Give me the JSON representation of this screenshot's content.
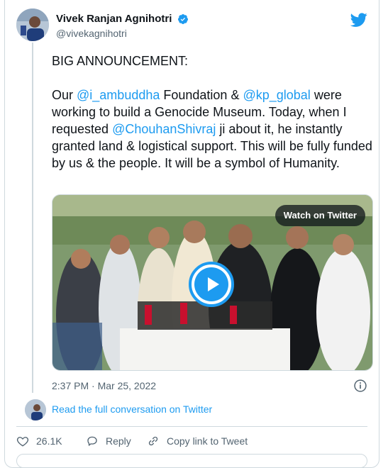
{
  "author": {
    "name": "Vivek Ranjan Agnihotri",
    "handle": "@vivekagnihotri",
    "verified": true,
    "avatar_icon": "profile-avatar"
  },
  "brand_icon": "twitter-bird-icon",
  "colors": {
    "accent": "#1d9bf0",
    "text": "#0f1419",
    "muted": "#536471",
    "border": "#cfd9de"
  },
  "tweet": {
    "line1": "BIG ANNOUNCEMENT:",
    "para2": {
      "t1": "Our ",
      "m1": "@i_ambuddha",
      "t2": " Foundation & ",
      "m2": "@kp_global",
      "t3": " were working to build a Genocide Museum. Today, when I requested ",
      "m3": "@ChouhanShivraj",
      "t4": " ji about it, he instantly granted land & logistical support. This will be fully funded by us & the people. It will be a symbol of Humanity."
    }
  },
  "media": {
    "watch_label": "Watch on Twitter",
    "play_icon": "play-icon"
  },
  "timestamp": "2:37 PM · Mar 25, 2022",
  "read_conversation": "Read the full conversation on Twitter",
  "actions": {
    "likes": "26.1K",
    "reply": "Reply",
    "copy_link": "Copy link to Tweet"
  }
}
